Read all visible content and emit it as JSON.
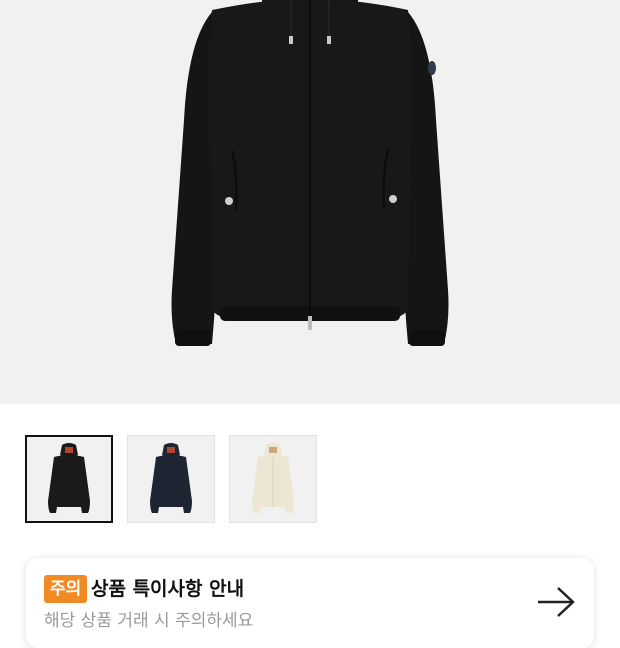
{
  "product": {
    "main_image": "black-hooded-zip-jacket",
    "thumbnails": [
      {
        "name": "black-jacket-thumbnail",
        "color": "#1a1a1a",
        "selected": true
      },
      {
        "name": "navy-jacket-thumbnail",
        "color": "#1f2433",
        "selected": false
      },
      {
        "name": "ivory-jacket-thumbnail",
        "color": "#ece6d3",
        "selected": false
      }
    ]
  },
  "notice": {
    "badge": "주의",
    "title": "상품 특이사항 안내",
    "subtitle": "해당 상품 거래 시 주의하세요",
    "arrow_icon": "arrow-right-icon"
  },
  "colors": {
    "accent": "#f08a24",
    "hero_background": "#f1f1f1"
  }
}
